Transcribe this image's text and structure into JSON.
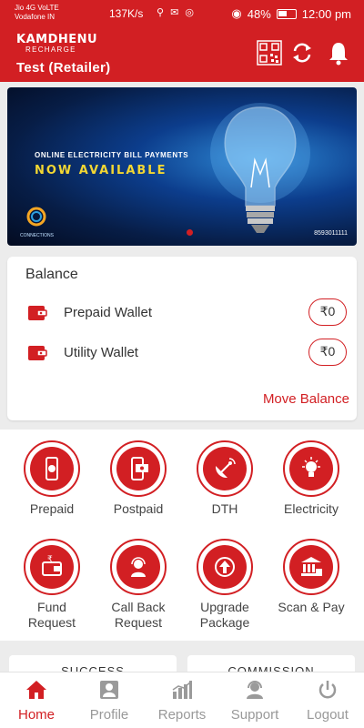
{
  "status_bar": {
    "carrier_line1": "Jio 4G VoLTE",
    "carrier_line2": "Vodafone IN",
    "speed": "137K/s",
    "battery": "48%",
    "time": "12:00 pm"
  },
  "header": {
    "logo_line1": "KAMDHENU",
    "logo_line2": "RECHARGE",
    "user": "Test (Retailer)"
  },
  "banner": {
    "line1": "ONLINE ELECTRICITY BILL PAYMENTS",
    "line2": "NOW AVAILABLE",
    "phone": "8593011111",
    "brand": "CONNECTIONS"
  },
  "balance": {
    "title": "Balance",
    "wallets": [
      {
        "label": "Prepaid Wallet",
        "value": "₹0"
      },
      {
        "label": "Utility Wallet",
        "value": "₹0"
      }
    ],
    "move_label": "Move Balance"
  },
  "services": [
    {
      "label": "Prepaid",
      "icon": "mobile-rupee-icon"
    },
    {
      "label": "Postpaid",
      "icon": "mobile-bill-icon"
    },
    {
      "label": "DTH",
      "icon": "satellite-dish-icon"
    },
    {
      "label": "Electricity",
      "icon": "bulb-icon"
    },
    {
      "label": "Fund\nRequest",
      "icon": "wallet-rupee-icon"
    },
    {
      "label": "Call Back\nRequest",
      "icon": "headset-icon"
    },
    {
      "label": "Upgrade\nPackage",
      "icon": "upgrade-arrow-icon"
    },
    {
      "label": "Scan & Pay",
      "icon": "bank-qr-icon"
    }
  ],
  "stats": {
    "success_label": "SUCCESS",
    "commission_label": "COMMISSION"
  },
  "nav": [
    {
      "label": "Home",
      "icon": "home-icon",
      "active": true
    },
    {
      "label": "Profile",
      "icon": "profile-icon",
      "active": false
    },
    {
      "label": "Reports",
      "icon": "reports-icon",
      "active": false
    },
    {
      "label": "Support",
      "icon": "support-icon",
      "active": false
    },
    {
      "label": "Logout",
      "icon": "power-icon",
      "active": false
    }
  ],
  "colors": {
    "brand": "#d21f23",
    "accent_text": "#f3d733"
  }
}
